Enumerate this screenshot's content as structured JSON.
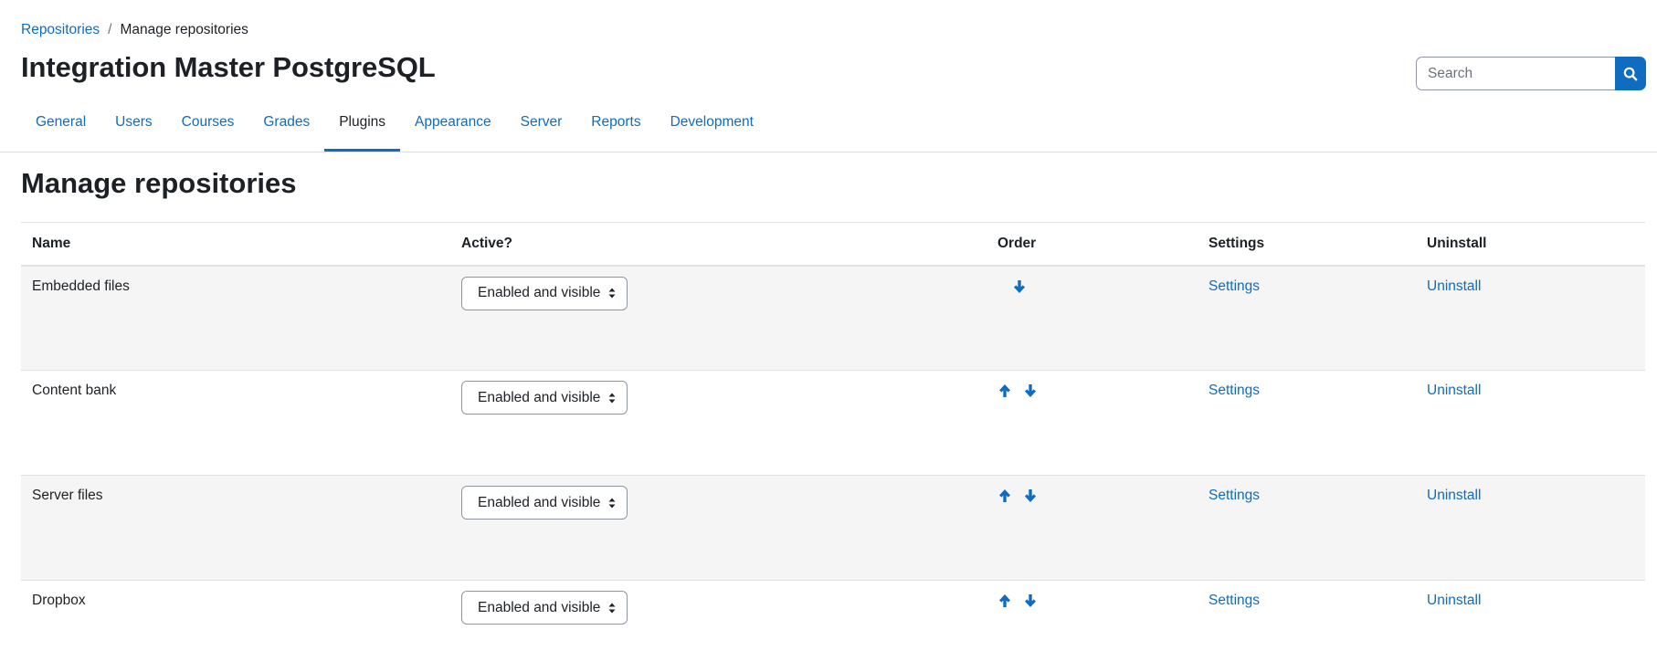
{
  "breadcrumb": {
    "parent": "Repositories",
    "separator": "/",
    "current": "Manage repositories"
  },
  "site": {
    "title": "Integration Master PostgreSQL"
  },
  "search": {
    "placeholder": "Search",
    "icon": "search-icon"
  },
  "tabs": [
    {
      "label": "General",
      "active": false
    },
    {
      "label": "Users",
      "active": false
    },
    {
      "label": "Courses",
      "active": false
    },
    {
      "label": "Grades",
      "active": false
    },
    {
      "label": "Plugins",
      "active": true
    },
    {
      "label": "Appearance",
      "active": false
    },
    {
      "label": "Server",
      "active": false
    },
    {
      "label": "Reports",
      "active": false
    },
    {
      "label": "Development",
      "active": false
    }
  ],
  "page": {
    "heading": "Manage repositories"
  },
  "table": {
    "headers": {
      "name": "Name",
      "active": "Active?",
      "order": "Order",
      "settings": "Settings",
      "uninstall": "Uninstall"
    },
    "rows": [
      {
        "name": "Embedded files",
        "active": "Enabled and visible",
        "can_move_up": false,
        "can_move_down": true,
        "settings": "Settings",
        "uninstall": "Uninstall"
      },
      {
        "name": "Content bank",
        "active": "Enabled and visible",
        "can_move_up": true,
        "can_move_down": true,
        "settings": "Settings",
        "uninstall": "Uninstall"
      },
      {
        "name": "Server files",
        "active": "Enabled and visible",
        "can_move_up": true,
        "can_move_down": true,
        "settings": "Settings",
        "uninstall": "Uninstall"
      },
      {
        "name": "Dropbox",
        "active": "Enabled and visible",
        "can_move_up": true,
        "can_move_down": true,
        "settings": "Settings",
        "uninstall": "Uninstall"
      }
    ]
  },
  "colors": {
    "link": "#0f6cbf",
    "text": "#1d2125",
    "row_stripe": "#f5f5f5",
    "border": "#dee2e6"
  }
}
